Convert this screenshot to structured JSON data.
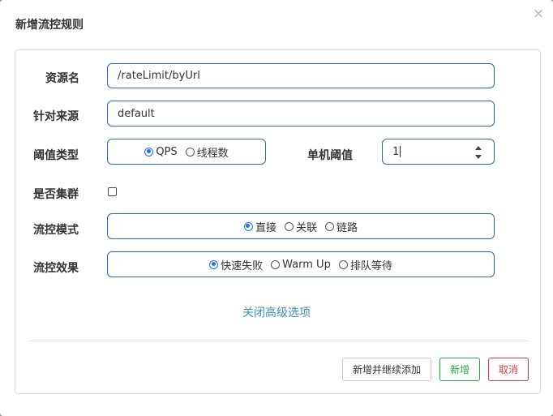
{
  "dialog": {
    "title": "新增流控规则",
    "close_symbol": "×"
  },
  "form": {
    "resource": {
      "label": "资源名",
      "value": "/rateLimit/byUrl"
    },
    "limit_app": {
      "label": "针对来源",
      "value": "default"
    },
    "threshold_type": {
      "label": "阈值类型",
      "options": [
        "QPS",
        "线程数"
      ],
      "selected": "QPS"
    },
    "single_threshold": {
      "label": "单机阈值",
      "value": "1"
    },
    "cluster": {
      "label": "是否集群",
      "checked": false
    },
    "control_mode": {
      "label": "流控模式",
      "options": [
        "直接",
        "关联",
        "链路"
      ],
      "selected": "直接"
    },
    "control_effect": {
      "label": "流控效果",
      "options": [
        "快速失败",
        "Warm Up",
        "排队等待"
      ],
      "selected": "快速失败"
    },
    "advanced_link": "关闭高级选项"
  },
  "footer": {
    "add_continue_label": "新增并继续添加",
    "add_label": "新增",
    "cancel_label": "取消"
  },
  "colors": {
    "accent": "#1a73e8",
    "input_border": "#2f6aa6",
    "link": "#3c8dbc",
    "success": "#28a745",
    "danger": "#dc3545"
  }
}
